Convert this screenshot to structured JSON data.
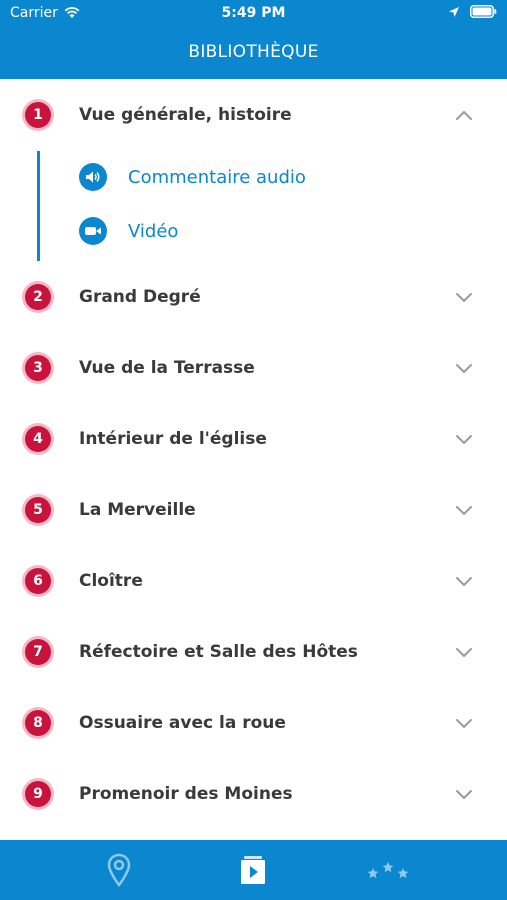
{
  "status_bar": {
    "carrier": "Carrier",
    "time": "5:49 PM"
  },
  "header": {
    "title": "BIBLIOTHÈQUE"
  },
  "sections": [
    {
      "number": "1",
      "label": "Vue générale, histoire",
      "expanded": true,
      "items": [
        {
          "label": "Commentaire audio",
          "icon": "speaker-icon"
        },
        {
          "label": "Vidéo",
          "icon": "video-camera-icon"
        }
      ]
    },
    {
      "number": "2",
      "label": "Grand Degré",
      "expanded": false
    },
    {
      "number": "3",
      "label": "Vue de la Terrasse",
      "expanded": false
    },
    {
      "number": "4",
      "label": "Intérieur de l'église",
      "expanded": false
    },
    {
      "number": "5",
      "label": "La Merveille",
      "expanded": false
    },
    {
      "number": "6",
      "label": "Cloître",
      "expanded": false
    },
    {
      "number": "7",
      "label": "Réfectoire et Salle des Hôtes",
      "expanded": false
    },
    {
      "number": "8",
      "label": "Ossuaire avec la roue",
      "expanded": false
    },
    {
      "number": "9",
      "label": "Promenoir des Moines",
      "expanded": false
    }
  ],
  "tab_bar": {
    "tabs": [
      {
        "icon": "map-pin-icon",
        "active": false
      },
      {
        "icon": "library-play-icon",
        "active": true
      },
      {
        "icon": "stars-icon",
        "active": false
      }
    ]
  },
  "colors": {
    "primary": "#0a87cf",
    "badge": "#c8143c",
    "badge_ring": "#f4b8c6",
    "text": "#3a3a3a"
  }
}
